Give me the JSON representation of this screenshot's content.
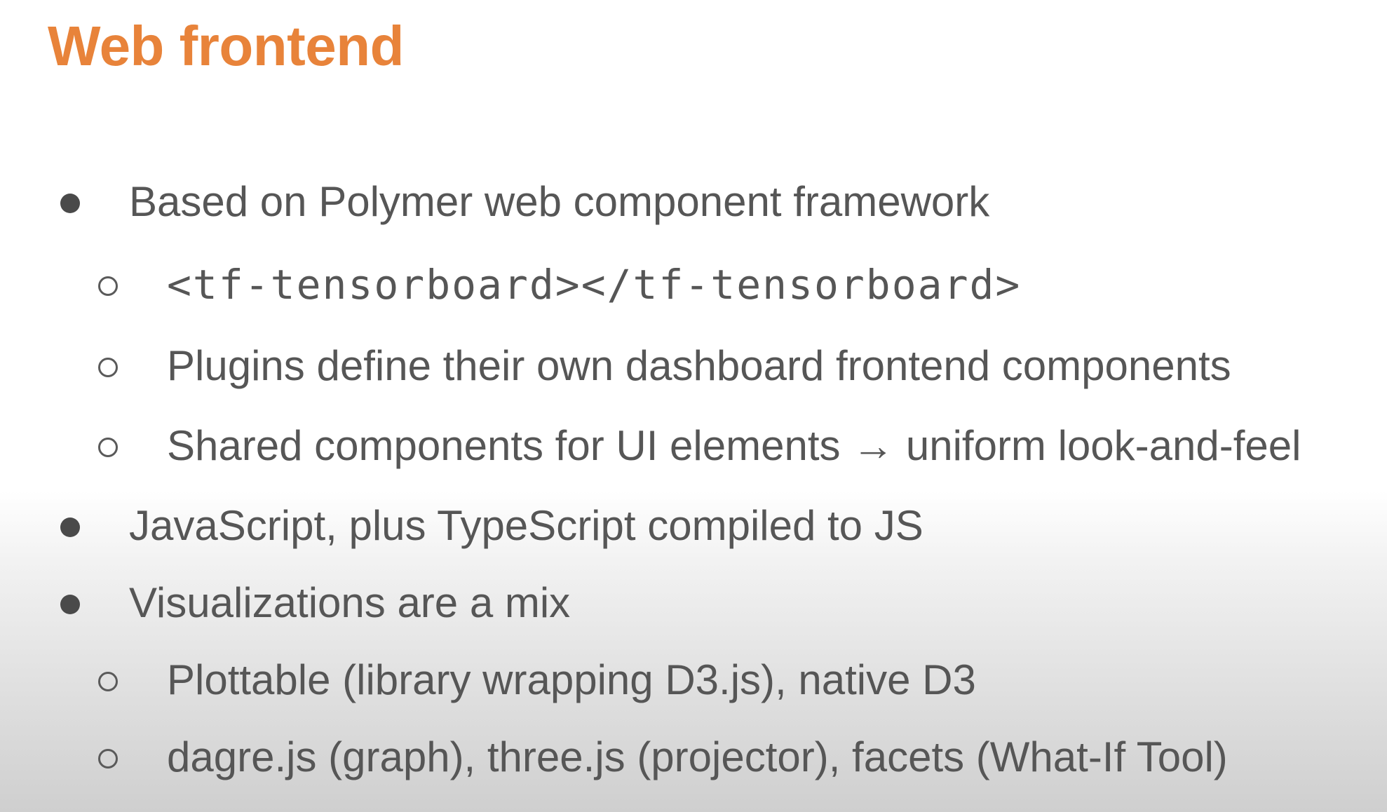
{
  "slide": {
    "title": "Web frontend",
    "bullets": [
      {
        "level": 1,
        "marker": "filled-circle",
        "text": "Based on Polymer web component framework"
      },
      {
        "level": 2,
        "marker": "hollow-circle",
        "text": "<tf-tensorboard></tf-tensorboard>",
        "monospace": true
      },
      {
        "level": 2,
        "marker": "hollow-circle",
        "text": "Plugins define their own dashboard frontend components"
      },
      {
        "level": 2,
        "marker": "hollow-circle",
        "text": "Shared components for UI elements → uniform look-and-feel"
      },
      {
        "level": 1,
        "marker": "filled-circle",
        "text": "JavaScript, plus TypeScript compiled to JS"
      },
      {
        "level": 1,
        "marker": "filled-circle",
        "text": "Visualizations are a mix"
      },
      {
        "level": 2,
        "marker": "hollow-circle",
        "text": "Plottable (library wrapping D3.js), native D3"
      },
      {
        "level": 2,
        "marker": "hollow-circle",
        "text": "dagre.js (graph), three.js (projector), facets (What-If Tool)"
      }
    ]
  },
  "colors": {
    "title": "#e8833a",
    "body_text": "#565656",
    "bullet": "#4a4a4a"
  }
}
